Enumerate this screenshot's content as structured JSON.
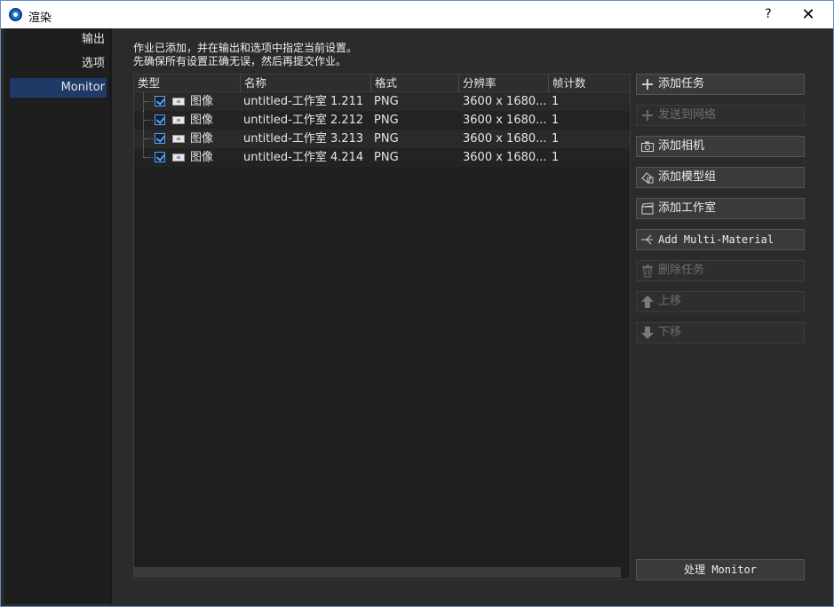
{
  "window": {
    "title": "渲染",
    "help_glyph": "?",
    "close_glyph": "✕"
  },
  "sidebar": {
    "items": [
      {
        "label": "输出"
      },
      {
        "label": "选项"
      },
      {
        "label": "Monitor"
      }
    ]
  },
  "info": {
    "line1": "作业已添加，并在输出和选项中指定当前设置。",
    "line2": "先确保所有设置正确无误，然后再提交作业。"
  },
  "table": {
    "headers": [
      "类型",
      "名称",
      "格式",
      "分辨率",
      "帧计数"
    ],
    "rows": [
      {
        "type": "图像",
        "name": "untitled-工作室 1.211",
        "format": "PNG",
        "resolution": "3600 x 1680...",
        "frames": "1"
      },
      {
        "type": "图像",
        "name": "untitled-工作室 2.212",
        "format": "PNG",
        "resolution": "3600 x 1680...",
        "frames": "1"
      },
      {
        "type": "图像",
        "name": "untitled-工作室 3.213",
        "format": "PNG",
        "resolution": "3600 x 1680...",
        "frames": "1"
      },
      {
        "type": "图像",
        "name": "untitled-工作室 4.214",
        "format": "PNG",
        "resolution": "3600 x 1680...",
        "frames": "1"
      }
    ]
  },
  "buttons": {
    "add_task": "添加任务",
    "send_network": "发送到网络",
    "add_camera": "添加相机",
    "add_model_group": "添加模型组",
    "add_studio": "添加工作室",
    "add_multi_material": "Add Multi-Material",
    "delete_task": "删除任务",
    "move_up": "上移",
    "move_down": "下移",
    "process": "处理 Monitor"
  }
}
